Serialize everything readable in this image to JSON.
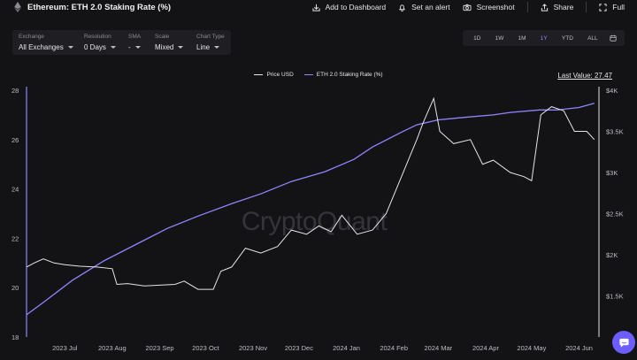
{
  "header": {
    "title": "Ethereum: ETH 2.0 Staking Rate (%)",
    "actions": [
      "Add to Dashboard",
      "Set an alert",
      "Screenshot",
      "Share",
      "Full"
    ]
  },
  "controls": [
    {
      "label": "Exchange",
      "value": "All Exchanges"
    },
    {
      "label": "Resolution",
      "value": "0 Days"
    },
    {
      "label": "SMA",
      "value": "-"
    },
    {
      "label": "Scale",
      "value": "Mixed"
    },
    {
      "label": "Chart Type",
      "value": "Line"
    }
  ],
  "ranges": [
    "1D",
    "1W",
    "1M",
    "1Y",
    "YTD",
    "ALL"
  ],
  "active_range": "1Y",
  "legend": [
    {
      "name": "Price USD",
      "color": "#e6e6ea"
    },
    {
      "name": "ETH 2.0 Staking Rate (%)",
      "color": "#8e86ff"
    }
  ],
  "last_value": "Last Value: 27.47",
  "watermark": "CryptoQuant",
  "colors": {
    "background": "#131316",
    "price": "#e6e6ea",
    "staking": "#8e86ff",
    "accent": "#6b5dff"
  },
  "chart_data": {
    "type": "line",
    "x_ticks": [
      "2023 Jul",
      "2023 Aug",
      "2023 Sep",
      "2023 Oct",
      "2023 Nov",
      "2023 Dec",
      "2024 Jan",
      "2024 Feb",
      "2024 Mar",
      "2024 Apr",
      "2024 May",
      "2024 Jun"
    ],
    "left_axis": {
      "ticks": [
        "18",
        "20",
        "22",
        "24",
        "26",
        "28"
      ],
      "ylim": [
        18,
        28
      ]
    },
    "right_axis": {
      "ticks": [
        "$1.5K",
        "$2K",
        "$2.5K",
        "$3K",
        "$3.5K",
        "$4K"
      ],
      "ylim": [
        1000,
        4000
      ]
    },
    "series": [
      {
        "name": "ETH 2.0 Staking Rate (%)",
        "axis": "left",
        "x": [
          "2023-06-20",
          "2023-07-01",
          "2023-07-20",
          "2023-08-10",
          "2023-09-01",
          "2023-09-20",
          "2023-10-10",
          "2023-11-01",
          "2023-11-20",
          "2023-12-10",
          "2024-01-01",
          "2024-01-20",
          "2024-02-01",
          "2024-02-20",
          "2024-03-01",
          "2024-03-15",
          "2024-04-01",
          "2024-04-20",
          "2024-05-01",
          "2024-05-20",
          "2024-06-01",
          "2024-06-15",
          "2024-06-25"
        ],
        "values": [
          18.9,
          19.4,
          20.3,
          21.1,
          21.8,
          22.4,
          22.9,
          23.4,
          23.8,
          24.3,
          24.7,
          25.2,
          25.7,
          26.3,
          26.6,
          26.8,
          26.9,
          27.0,
          27.1,
          27.2,
          27.2,
          27.3,
          27.47
        ]
      },
      {
        "name": "Price USD",
        "axis": "right",
        "x": [
          "2023-06-20",
          "2023-06-25",
          "2023-07-01",
          "2023-07-08",
          "2023-07-15",
          "2023-07-25",
          "2023-08-05",
          "2023-08-15",
          "2023-08-18",
          "2023-08-25",
          "2023-09-05",
          "2023-09-15",
          "2023-09-25",
          "2023-10-01",
          "2023-10-10",
          "2023-10-20",
          "2023-10-25",
          "2023-11-01",
          "2023-11-10",
          "2023-11-20",
          "2023-12-01",
          "2023-12-10",
          "2023-12-20",
          "2023-12-28",
          "2024-01-05",
          "2024-01-12",
          "2024-01-22",
          "2024-02-01",
          "2024-02-10",
          "2024-02-20",
          "2024-03-01",
          "2024-03-05",
          "2024-03-12",
          "2024-03-16",
          "2024-03-25",
          "2024-04-05",
          "2024-04-13",
          "2024-04-20",
          "2024-05-01",
          "2024-05-10",
          "2024-05-15",
          "2024-05-21",
          "2024-05-28",
          "2024-06-05",
          "2024-06-12",
          "2024-06-20",
          "2024-06-25"
        ],
        "values": [
          1850,
          1900,
          1950,
          1900,
          1880,
          1860,
          1850,
          1830,
          1640,
          1650,
          1620,
          1630,
          1640,
          1680,
          1580,
          1580,
          1800,
          1850,
          2080,
          2020,
          2100,
          2300,
          2250,
          2350,
          2280,
          2480,
          2250,
          2300,
          2500,
          2950,
          3400,
          3600,
          3900,
          3500,
          3350,
          3400,
          3100,
          3150,
          3000,
          2950,
          2900,
          3700,
          3800,
          3750,
          3500,
          3500,
          3400
        ]
      }
    ]
  }
}
